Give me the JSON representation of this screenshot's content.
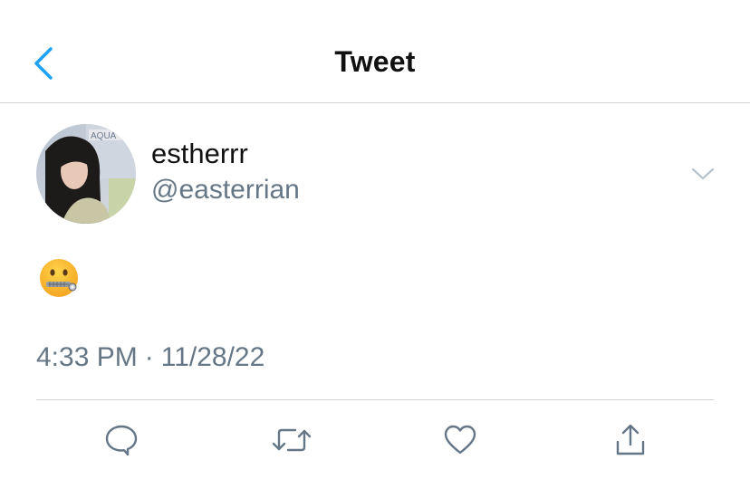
{
  "header": {
    "title": "Tweet",
    "back_icon": "chevron-left-icon"
  },
  "author": {
    "display_name": "estherrr",
    "handle": "@easterrian",
    "avatar_sign_text": "AQUA"
  },
  "tweet": {
    "emoji_icon": "zipper-mouth-face-emoji",
    "time": "4:33 PM",
    "separator": "·",
    "date": "11/28/22"
  },
  "actions": [
    {
      "name": "reply",
      "icon": "reply-bubble-icon"
    },
    {
      "name": "retweet",
      "icon": "retweet-arrows-icon"
    },
    {
      "name": "like",
      "icon": "heart-icon"
    },
    {
      "name": "share",
      "icon": "share-upload-icon"
    }
  ],
  "colors": {
    "accent": "#1DA1F2",
    "secondary_text": "#657786",
    "primary_text": "#111111",
    "divider": "#d4d4d4"
  }
}
